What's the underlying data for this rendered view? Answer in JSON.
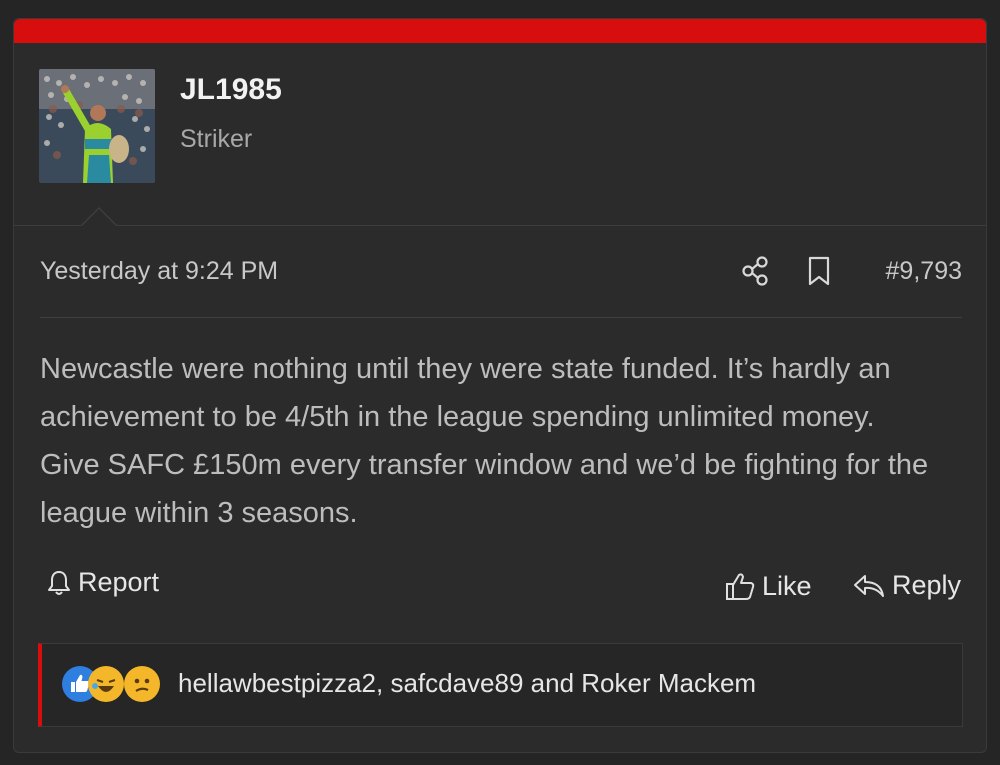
{
  "post": {
    "user": {
      "name": "JL1985",
      "title": "Striker"
    },
    "timestamp": "Yesterday at 9:24 PM",
    "post_number": "#9,793",
    "body": "Newcastle were nothing until they were state funded. It’s hardly an achievement to be 4/5th in the league spending unlimited money. Give SAFC £150m every transfer window and we’d be fighting for the league within 3 seasons.",
    "actions": {
      "report_label": "Report",
      "like_label": "Like",
      "reply_label": "Reply"
    },
    "reactions": {
      "icons": [
        "like-reaction-icon",
        "laugh-reaction-icon",
        "confused-reaction-icon"
      ],
      "names": "hellawbestpizza2, safcdave89 and Roker Mackem"
    }
  },
  "colors": {
    "accent_red": "#d80e0e",
    "background": "#252525",
    "card": "#2b2b2b"
  }
}
